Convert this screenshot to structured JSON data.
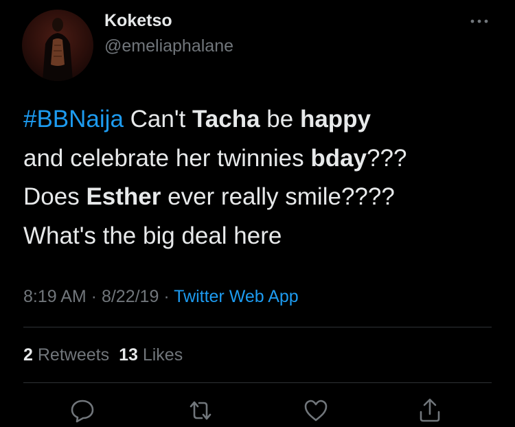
{
  "author": {
    "name": "Koketso",
    "handle": "@emeliaphalane"
  },
  "tweet": {
    "line1": {
      "hashtag": "#BBNaija",
      "t1": " Can't ",
      "b1": "Tacha",
      "t2": " be ",
      "b2": "happy"
    },
    "line2": {
      "t1": "and celebrate her twinnies ",
      "b1": "bday",
      "t2": "???"
    },
    "line3": {
      "t1": "Does ",
      "b1": "Esther",
      "t2": " ever really smile????"
    },
    "line4": {
      "t1": "What's the big deal here"
    }
  },
  "meta": {
    "time": "8:19 AM",
    "sep1": " · ",
    "date": "8/22/19",
    "sep2": " · ",
    "source": "Twitter Web App"
  },
  "stats": {
    "retweets_count": "2",
    "retweets_label": "Retweets",
    "likes_count": "13",
    "likes_label": "Likes"
  },
  "actions": {
    "reply_icon": "reply-icon",
    "retweet_icon": "retweet-icon",
    "like_icon": "heart-icon",
    "share_icon": "share-icon"
  },
  "colors": {
    "background": "#000000",
    "text": "#e7e9ea",
    "secondary": "#71767b",
    "accent": "#1d9bf0",
    "divider": "#2f3336"
  }
}
